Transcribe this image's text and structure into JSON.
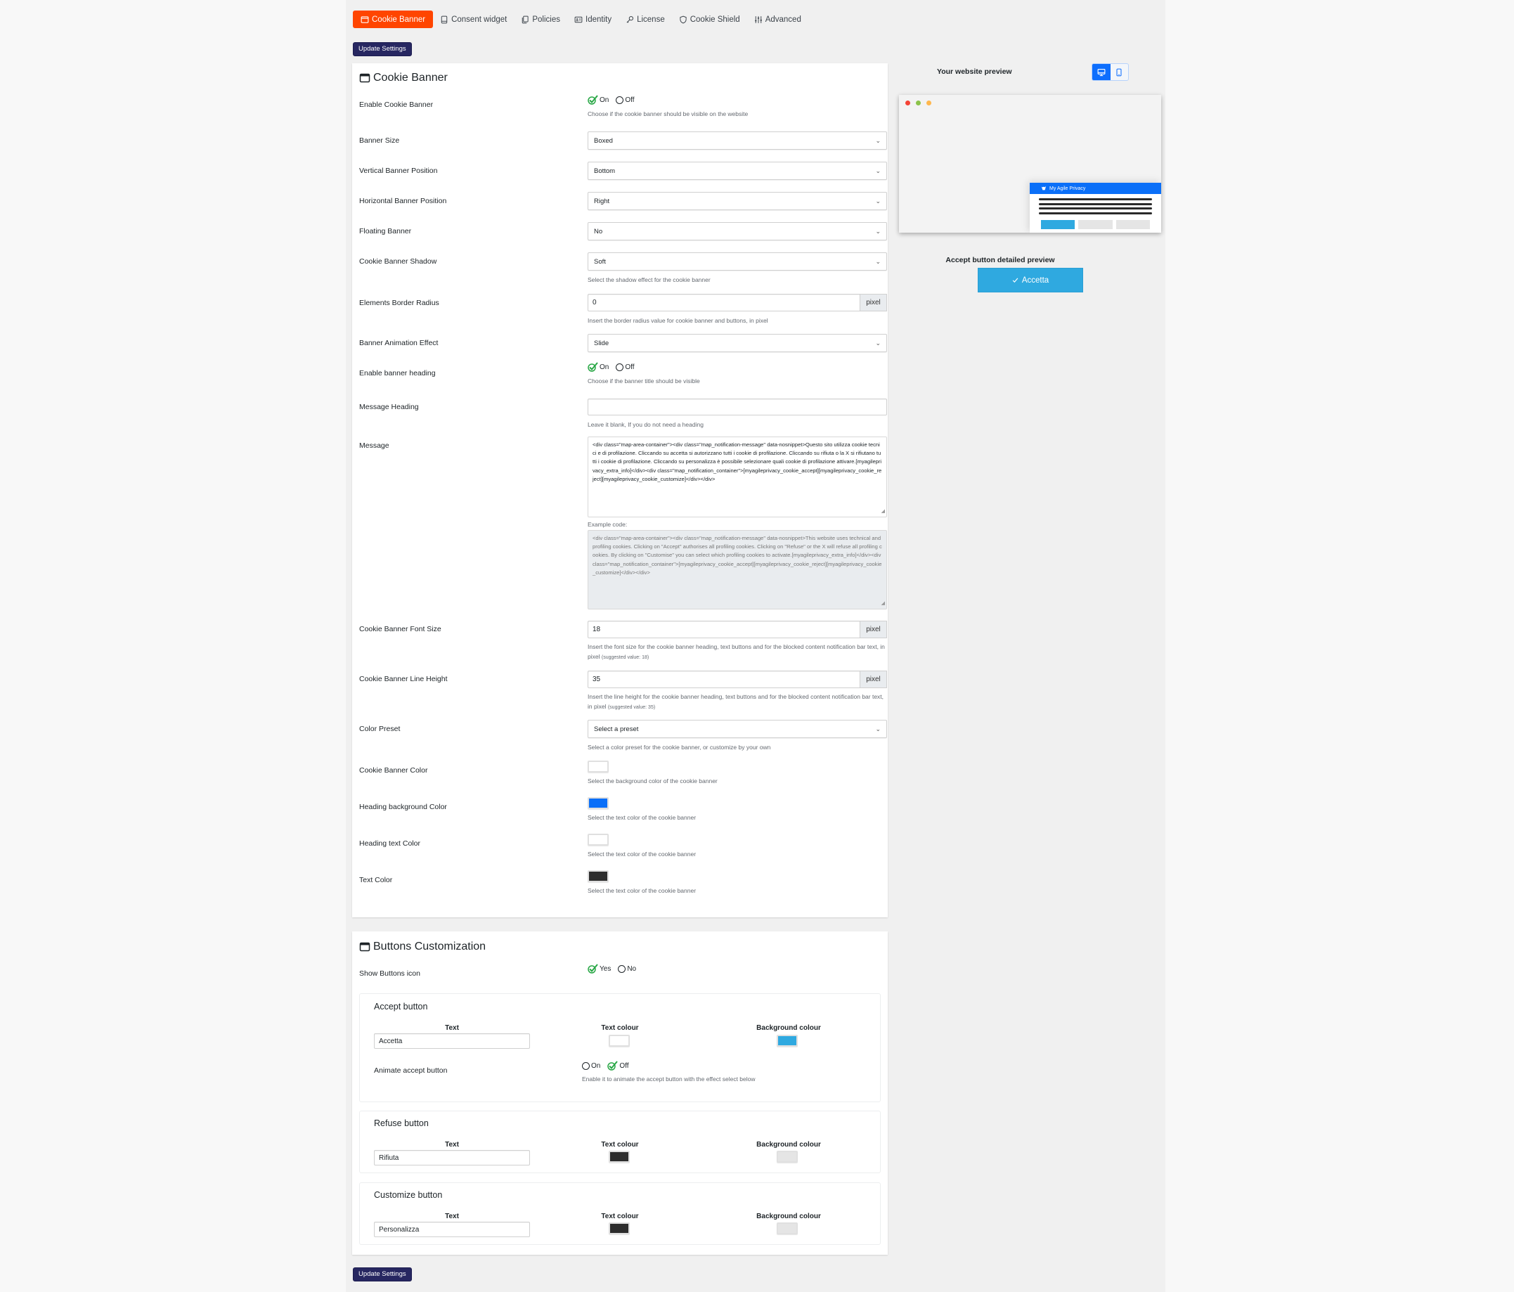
{
  "tabs": [
    {
      "label": "Cookie Banner",
      "icon": "window-icon",
      "active": true
    },
    {
      "label": "Consent widget",
      "icon": "tablet-icon",
      "active": false
    },
    {
      "label": "Policies",
      "icon": "documents-icon",
      "active": false
    },
    {
      "label": "Identity",
      "icon": "id-card-icon",
      "active": false
    },
    {
      "label": "License",
      "icon": "key-icon",
      "active": false
    },
    {
      "label": "Cookie Shield",
      "icon": "shield-icon",
      "active": false
    },
    {
      "label": "Advanced",
      "icon": "sliders-icon",
      "active": false
    }
  ],
  "update_button": "Update Settings",
  "cookie_banner": {
    "title": "Cookie Banner",
    "enable": {
      "label": "Enable Cookie Banner",
      "on": "On",
      "off": "Off",
      "value": "On",
      "help": "Choose if the cookie banner should be visible on the website"
    },
    "banner_size": {
      "label": "Banner Size",
      "value": "Boxed"
    },
    "vertical_position": {
      "label": "Vertical Banner Position",
      "value": "Bottom"
    },
    "horizontal_position": {
      "label": "Horizontal Banner Position",
      "value": "Right"
    },
    "floating": {
      "label": "Floating Banner",
      "value": "No"
    },
    "shadow": {
      "label": "Cookie Banner Shadow",
      "value": "Soft",
      "help": "Select the shadow effect for the cookie banner"
    },
    "border_radius": {
      "label": "Elements Border Radius",
      "value": "0",
      "unit": "pixel",
      "help": "Insert the border radius value for cookie banner and buttons, in pixel"
    },
    "animation": {
      "label": "Banner Animation Effect",
      "value": "Slide"
    },
    "enable_heading": {
      "label": "Enable banner heading",
      "on": "On",
      "off": "Off",
      "value": "On",
      "help": "Choose if the banner title should be visible"
    },
    "message_heading": {
      "label": "Message Heading",
      "value": "",
      "help": "Leave it blank, If you do not need a heading"
    },
    "message": {
      "label": "Message",
      "value": "<div class=\"map-area-container\"><div class=\"map_notification-message\" data-nosnippet>Questo sito utilizza cookie tecnici e di profilazione. Cliccando su accetta si autorizzano tutti i cookie di profilazione. Cliccando su rifiuta o la X si rifiutano tutti i cookie di profilazione. Cliccando su personalizza è possibile selezionare quali cookie di profilazione attivare.[myagileprivacy_extra_info]</div><div class=\"map_notification_container\">[myagileprivacy_cookie_accept][myagileprivacy_cookie_reject][myagileprivacy_cookie_customize]</div></div>",
      "example_label": "Example code:",
      "example": "<div class=\"map-area-container\"><div class=\"map_notification-message\" data-nosnippet>This website uses technical and profiling cookies. Clicking on \"Accept\" authorises all profiling cookies. Clicking on \"Refuse\" or the X will refuse all profiling cookies. By clicking on \"Customise\" you can select which profiling cookies to activate.[myagileprivacy_extra_info]</div><div class=\"map_notification_container\">[myagileprivacy_cookie_accept][myagileprivacy_cookie_reject][myagileprivacy_cookie_customize]</div></div>"
    },
    "font_size": {
      "label": "Cookie Banner Font Size",
      "value": "18",
      "unit": "pixel",
      "help": "Insert the font size for the cookie banner heading, text buttons and for the blocked content notification bar text, in pixel",
      "suggested": "(suggested value: 18)"
    },
    "line_height": {
      "label": "Cookie Banner Line Height",
      "value": "35",
      "unit": "pixel",
      "help": "Insert the line height for the cookie banner heading, text buttons and for the blocked content notification bar text, in pixel",
      "suggested": "(suggested value: 35)"
    },
    "color_preset": {
      "label": "Color Preset",
      "value": "Select a preset",
      "help": "Select a color preset for the cookie banner, or customize by your own"
    },
    "banner_color": {
      "label": "Cookie Banner Color",
      "color": "#ffffff",
      "help": "Select the background color of the cookie banner"
    },
    "heading_bg_color": {
      "label": "Heading background Color",
      "color": "#0a6ff8",
      "help": "Select the text color of the cookie banner"
    },
    "heading_text_color": {
      "label": "Heading text Color",
      "color": "#ffffff",
      "help": "Select the text color of the cookie banner"
    },
    "text_color": {
      "label": "Text Color",
      "color": "#2d2d2d",
      "help": "Select the text color of the cookie banner"
    }
  },
  "buttons": {
    "title": "Buttons Customization",
    "show_icon": {
      "label": "Show Buttons icon",
      "yes": "Yes",
      "no": "No",
      "value": "Yes"
    },
    "col_text": "Text",
    "col_text_colour": "Text colour",
    "col_bg_colour": "Background colour",
    "accept": {
      "title": "Accept button",
      "text": "Accetta",
      "text_color": "#ffffff",
      "bg_color": "#2fa9e0",
      "animate": {
        "label": "Animate accept button",
        "on": "On",
        "off": "Off",
        "value": "Off",
        "help": "Enable it to animate the accept button with the effect select below"
      }
    },
    "refuse": {
      "title": "Refuse button",
      "text": "Rifiuta",
      "text_color": "#2d2d2d",
      "bg_color": "#e5e5e5"
    },
    "customize": {
      "title": "Customize button",
      "text": "Personalizza",
      "text_color": "#2d2d2d",
      "bg_color": "#e5e5e5"
    }
  },
  "preview": {
    "label": "Your website preview",
    "devices": [
      "desktop",
      "mobile"
    ],
    "active_device": "desktop",
    "banner_brand": "My Agile Privacy",
    "accept_title": "Accept button detailed preview",
    "accept_label": "Accetta"
  },
  "colors": {
    "accent_tab": "#ff4500",
    "update_button": "#272761",
    "check_green": "#28a745"
  }
}
